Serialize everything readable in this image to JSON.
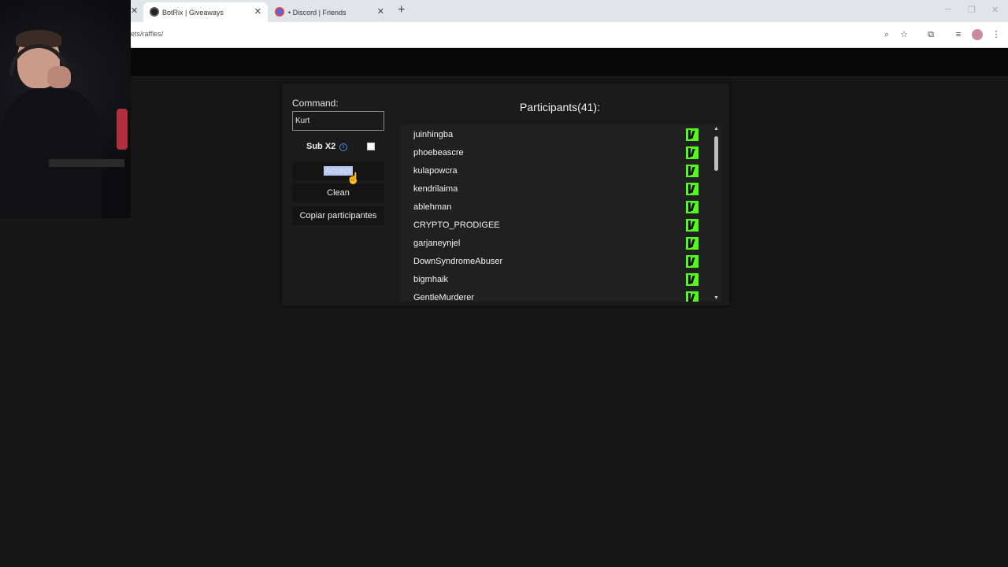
{
  "browser": {
    "tabs": [
      {
        "title": "BotRix | Giveaways",
        "active": true
      },
      {
        "title": "• Discord | Friends",
        "active": false
      }
    ],
    "url": "ets/raffles/"
  },
  "giveaway": {
    "command_label": "Command:",
    "command_value": "Kurt",
    "sub_x2_label": "Sub X2",
    "sub_x2_checked": false,
    "accept_label": "Accept",
    "clean_label": "Clean",
    "copy_label": "Copiar participantes",
    "participants_title": "Participants(41):",
    "participants": [
      "juinhingba",
      "phoebeascre",
      "kulapowcra",
      "kendrilaima",
      "ablehman",
      "CRYPTO_PRODIGEE",
      "garjaneynjel",
      "DownSyndromeAbuser",
      "bigmhaik",
      "GentleMurderer"
    ],
    "platform_icon": "kick-icon",
    "accent_color": "#53fc18"
  }
}
